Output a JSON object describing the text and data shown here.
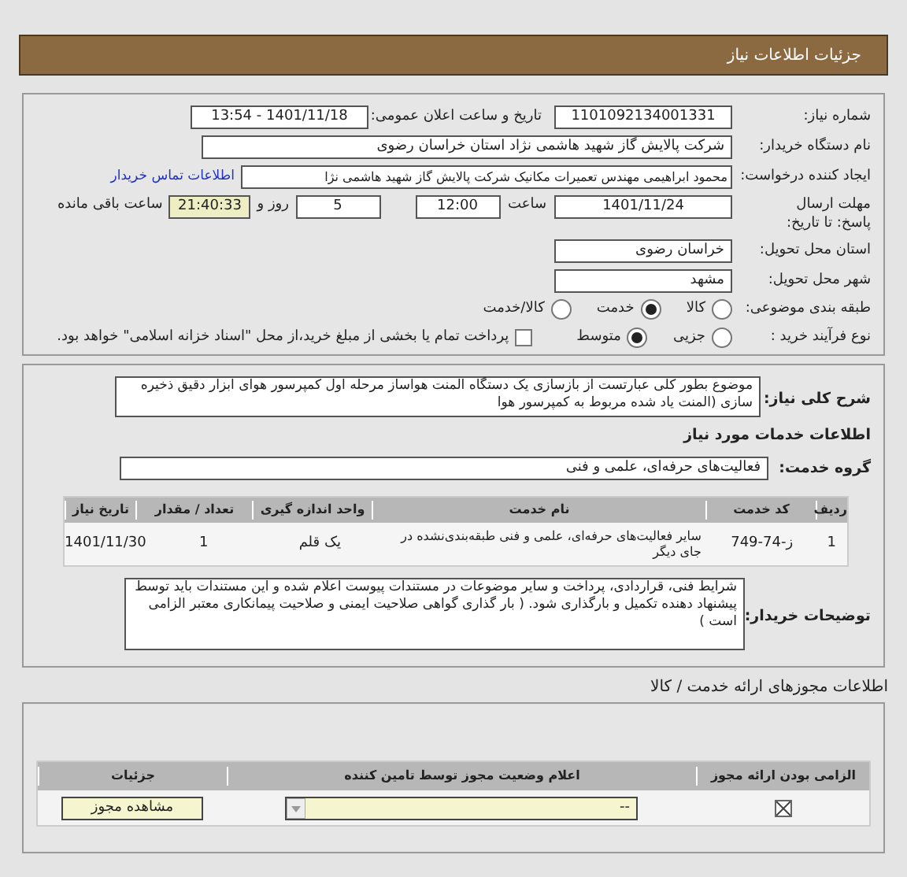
{
  "header": {
    "title": "جزئیات اطلاعات نیاز"
  },
  "need_number": {
    "label": "شماره نیاز:",
    "value": "1101092134001331"
  },
  "announce": {
    "label": "تاریخ و ساعت اعلان عمومی:",
    "value": "1401/11/18 - 13:54"
  },
  "buyer": {
    "label": "نام دستگاه خریدار:",
    "value": "شرکت پالایش گاز شهید هاشمی نژاد   استان خراسان رضوی"
  },
  "requester": {
    "label": "ایجاد کننده درخواست:",
    "value": "محمود ابراهیمی مهندس تعمیرات مکانیک شرکت پالایش گاز شهید هاشمی نژا",
    "link": "اطلاعات تماس خریدار"
  },
  "deadline": {
    "label": "مهلت ارسال پاسخ: تا تاریخ:",
    "date": "1401/11/24",
    "time_label": "ساعت",
    "time": "12:00",
    "days": "5",
    "days_label": "روز و",
    "remaining": "21:40:33",
    "remaining_label": "ساعت باقی مانده"
  },
  "province": {
    "label": "استان محل تحویل:",
    "value": "خراسان رضوی"
  },
  "city": {
    "label": "شهر محل تحویل:",
    "value": "مشهد"
  },
  "category": {
    "label": "طبقه بندی موضوعی:",
    "options": [
      {
        "label": "کالا",
        "selected": false
      },
      {
        "label": "خدمت",
        "selected": true
      },
      {
        "label": "کالا/خدمت",
        "selected": false
      }
    ]
  },
  "purchase_type": {
    "label": "نوع فرآیند خرید :",
    "options": [
      {
        "label": "جزیی",
        "selected": false
      },
      {
        "label": "متوسط",
        "selected": true
      }
    ],
    "payment": {
      "label": "پرداخت تمام یا بخشی از مبلغ خرید،از محل \"اسناد خزانه اسلامی\" خواهد بود.",
      "checked": false
    }
  },
  "description": {
    "label": "شرح کلی نیاز:",
    "text": "موضوع بطور کلی عبارتست از بازسازی یک دستگاه المنت هواساز مرحله اول کمپرسور هوای ابزار دقیق ذخیره سازی (المنت یاد شده مربوط به کمپرسور هوا"
  },
  "services_title": "اطلاعات خدمات مورد نیاز",
  "service_group": {
    "label": "گروه خدمت:",
    "value": "فعالیت‌های حرفه‌ای، علمی و فنی"
  },
  "table": {
    "columns": [
      "ردیف",
      "کد خدمت",
      "نام خدمت",
      "واحد اندازه گیری",
      "تعداد / مقدار",
      "تاریخ نیاز"
    ],
    "rows": [
      [
        "1",
        "ز-74-749",
        "سایر فعالیت‌های حرفه‌ای، علمی و فنی طبقه‌بندی‌نشده در جای دیگر",
        "یک قلم",
        "1",
        "1401/11/30"
      ]
    ]
  },
  "buyer_notes": {
    "label": "توضیحات خریدار:",
    "text": "شرایط فنی، قراردادی، پرداخت و سایر موضوعات در مستندات پیوست اعلام شده و این مستندات باید توسط پیشنهاد دهنده تکمیل و  بارگذاری شود. ( بار گذاری گواهی صلاحیت ایمنی و صلاحیت پیمانکاری معتبر الزامی است )"
  },
  "permits": {
    "title": "اطلاعات مجوزهای ارائه خدمت / کالا",
    "columns": [
      "الزامی بودن ارائه مجوز",
      "اعلام وضعیت مجوز توسط تامین کننده",
      "جزئیات"
    ],
    "rows": [
      {
        "required": true,
        "status": "--",
        "button": "مشاهده مجوز"
      }
    ]
  }
}
